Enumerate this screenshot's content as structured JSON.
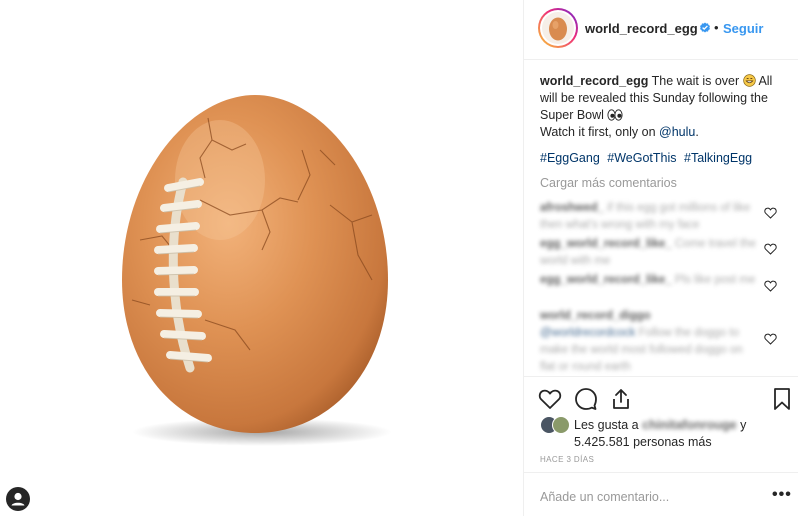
{
  "post": {
    "username": "world_record_egg",
    "follow_label": "Seguir",
    "dot": "•",
    "verified_icon": "verified-badge-icon",
    "caption": {
      "username": "world_record_egg",
      "text_1": "The wait is over",
      "text_2": "All will be revealed this Sunday following the Super Bowl",
      "text_3": "Watch it first, only on",
      "mention": "@hulu",
      "text_end": "."
    },
    "hashtags": [
      "#EggGang",
      "#WeGotThis",
      "#TalkingEgg"
    ],
    "load_more_label": "Cargar más comentarios",
    "comments": [
      {
        "user": "afroshwed_",
        "text": "if this egg got millions of like then what's wrong with my face"
      },
      {
        "user": "egg_world_record_like_",
        "text": "Come travel the world with me"
      },
      {
        "user": "egg_world_record_like_",
        "text": "Pls like post me"
      },
      {
        "user": "world_record_diggo",
        "link": "@worldrecordcock",
        "text": "Follow the doggo to make the world most followed doggo on flat or round earth"
      }
    ],
    "likes": {
      "prefix": "Les gusta a",
      "liker": "chinitafonrouge",
      "joiner": "y",
      "count": "5.425.581 personas más"
    },
    "timeago": "HACE 3 DÍAS",
    "add_comment_placeholder": "Añade un comentario...",
    "more_options_label": "•••"
  },
  "icons": {
    "like": "heart-icon",
    "comment": "comment-bubble-icon",
    "share": "share-icon",
    "save": "bookmark-icon",
    "user": "user-profile-icon"
  },
  "colors": {
    "follow": "#3897f0",
    "link": "#003569",
    "muted": "#999999",
    "text": "#262626",
    "egg": "#d98b4f",
    "lace": "#f2ece1"
  }
}
